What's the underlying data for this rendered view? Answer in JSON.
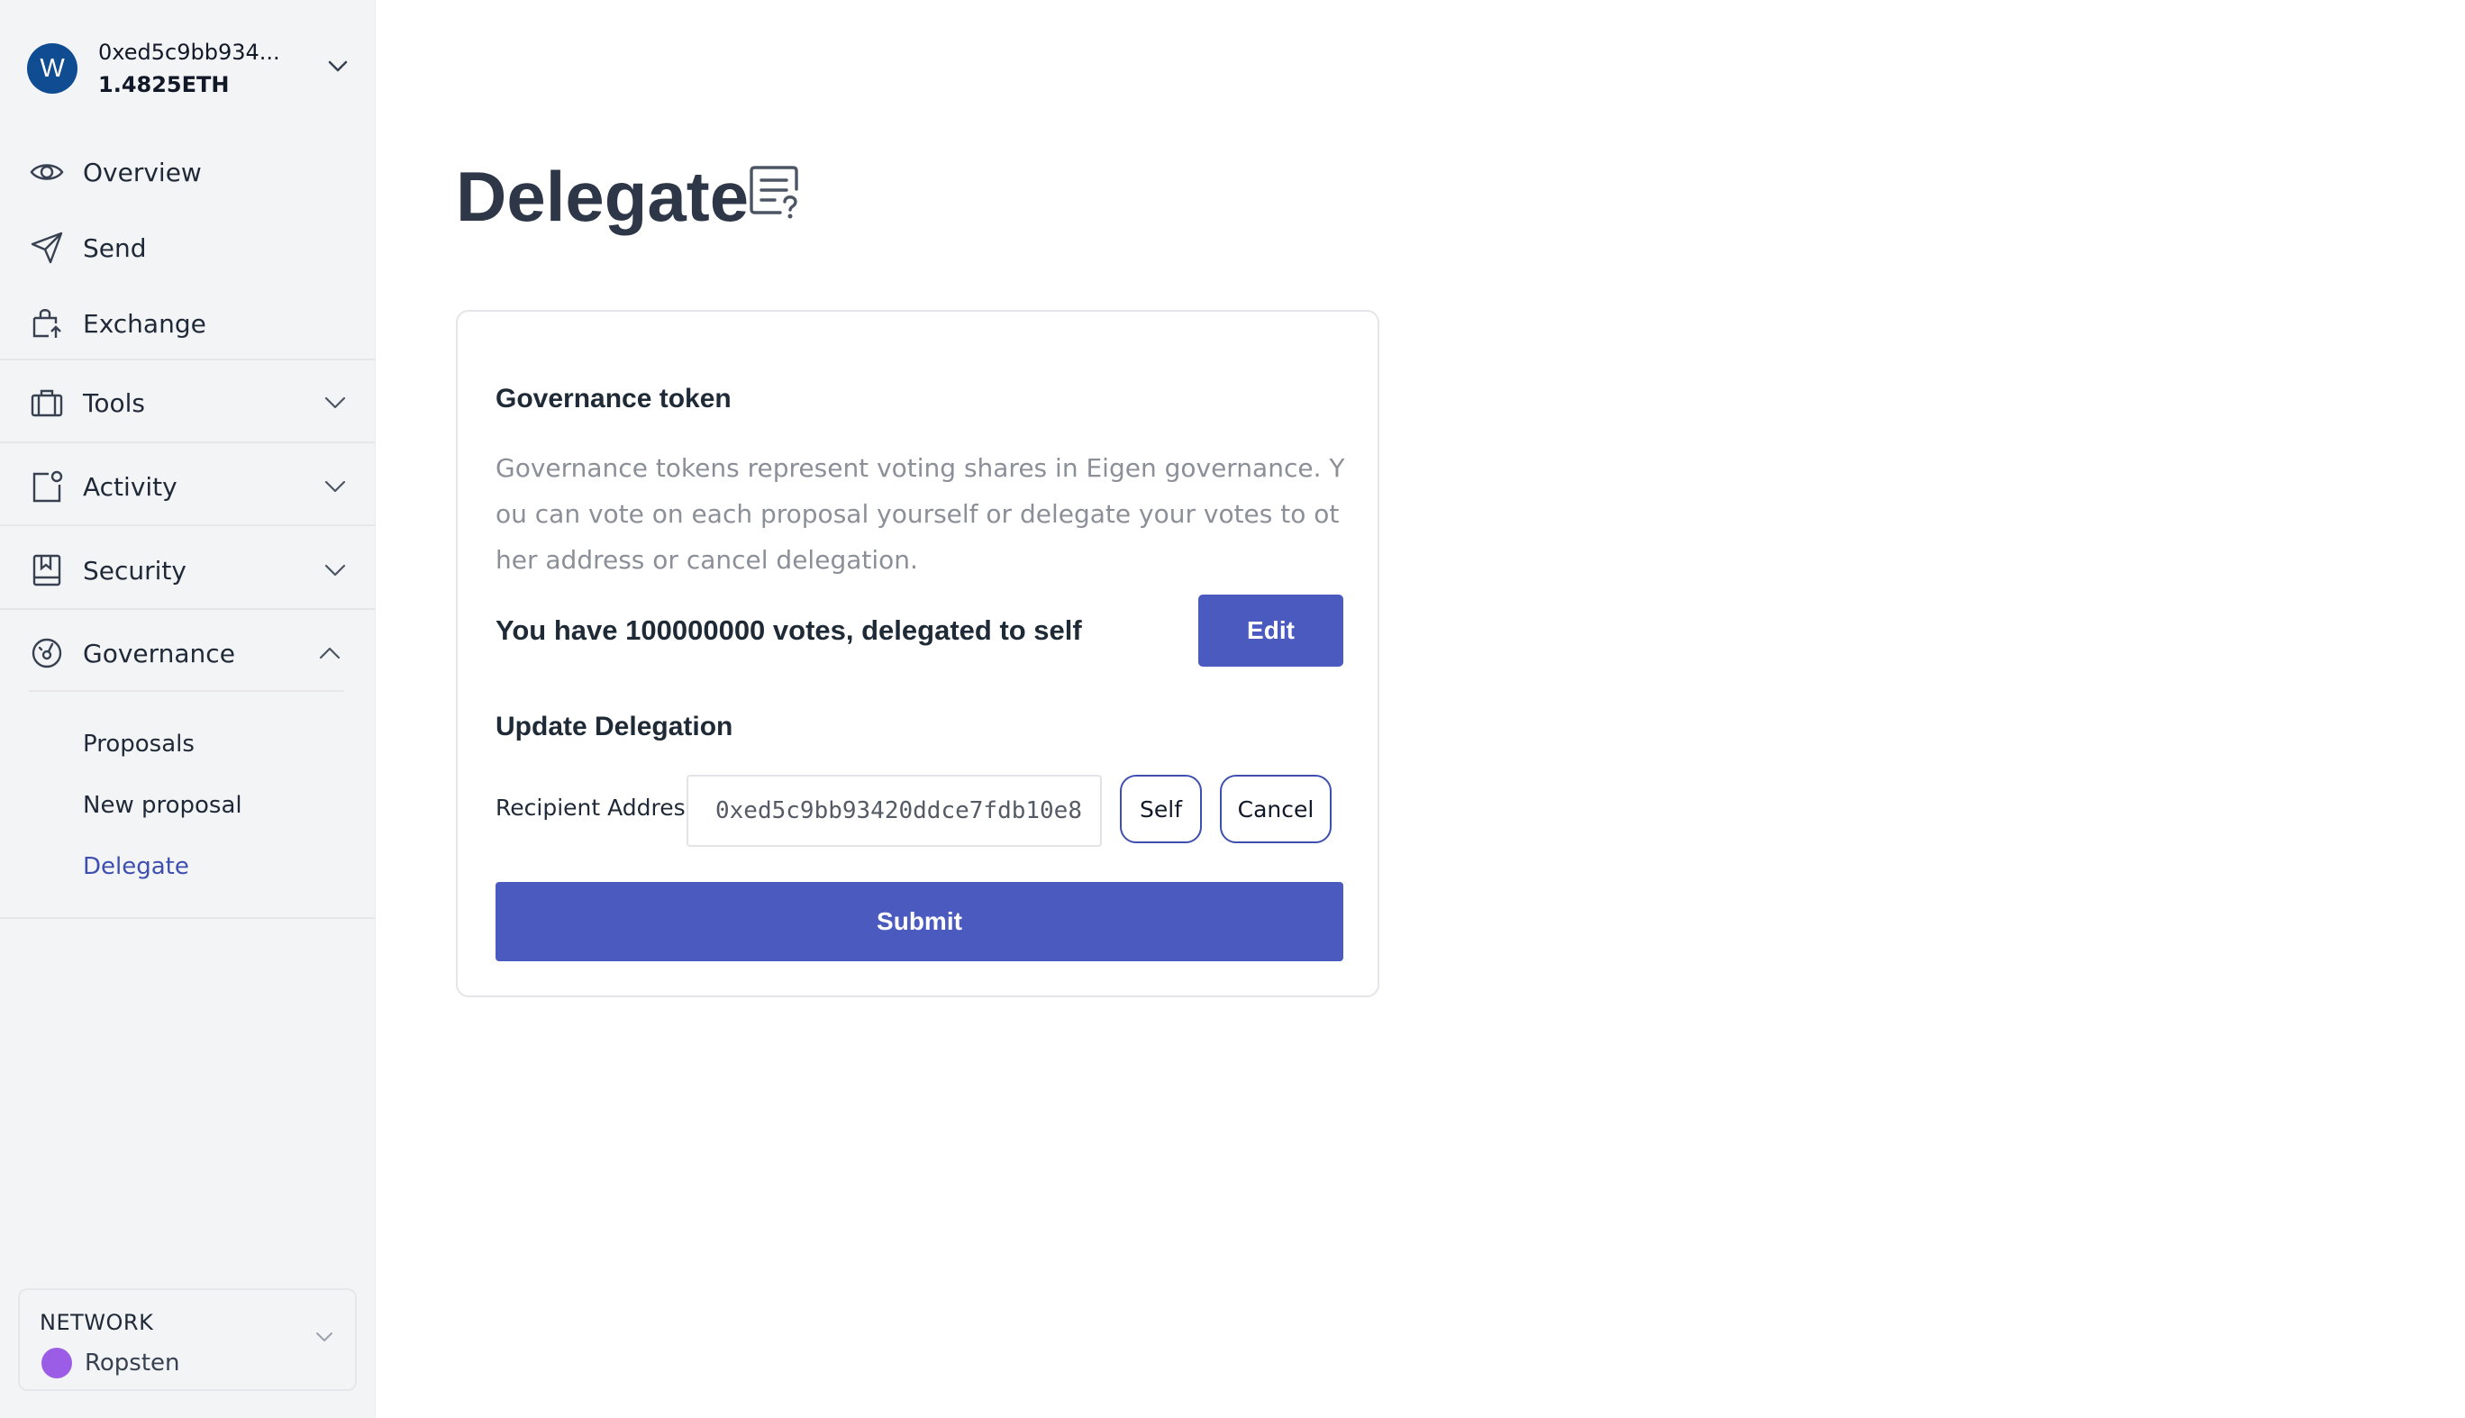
{
  "account": {
    "avatar_letter": "W",
    "address": "0xed5c9bb934...",
    "balance": "1.4825ETH"
  },
  "sidebar": {
    "items": [
      {
        "label": "Overview",
        "icon": "eye-icon"
      },
      {
        "label": "Send",
        "icon": "send-icon"
      },
      {
        "label": "Exchange",
        "icon": "exchange-icon"
      },
      {
        "label": "Tools",
        "icon": "toolbox-icon"
      },
      {
        "label": "Activity",
        "icon": "activity-icon"
      },
      {
        "label": "Security",
        "icon": "security-icon"
      },
      {
        "label": "Governance",
        "icon": "governance-icon"
      }
    ],
    "governance_sub": [
      {
        "label": "Proposals"
      },
      {
        "label": "New proposal"
      },
      {
        "label": "Delegate"
      }
    ],
    "active_sub": "Delegate"
  },
  "network": {
    "title": "NETWORK",
    "name": "Ropsten",
    "dot_color": "#9b5de5"
  },
  "page": {
    "title": "Delegate",
    "title_icon": "document-question-icon"
  },
  "card": {
    "section_title": "Governance token",
    "description": "Governance tokens represent voting shares in Eigen governance. You can vote on each proposal yourself or delegate your votes to other address or cancel delegation.",
    "votes_text": "You have 100000000 votes, delegated to self",
    "edit_label": "Edit",
    "update_title": "Update Delegation",
    "recipient_label": "Recipient Address",
    "recipient_value": "0xed5c9bb93420ddce7fdb10e8",
    "self_label": "Self",
    "cancel_label": "Cancel",
    "submit_label": "Submit"
  },
  "colors": {
    "accent": "#4a5abf",
    "avatar": "#0f4c92",
    "active_link": "#3e4fb0"
  }
}
